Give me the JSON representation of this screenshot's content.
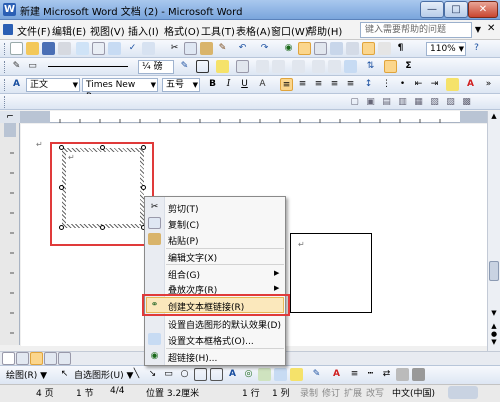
{
  "window": {
    "title": "新建 Microsoft Word 文档 (2) - Microsoft Word",
    "min_label": "—",
    "max_label": "□",
    "close_label": "✕"
  },
  "menubar": {
    "items": [
      "文件(F)",
      "编辑(E)",
      "视图(V)",
      "插入(I)",
      "格式(O)",
      "工具(T)",
      "表格(A)",
      "窗口(W)",
      "帮助(H)"
    ],
    "help_placeholder": "键入需要帮助的问题",
    "close_glyph": "✕"
  },
  "toolbar1": {
    "zoom": "110%"
  },
  "toolbar2": {
    "line_weight": "¼ 磅"
  },
  "formatting": {
    "style": "正文",
    "font": "Times New Roma",
    "size": "五号",
    "bold": "B",
    "italic": "I",
    "underline": "U"
  },
  "document": {
    "paragraph_mark": "↵",
    "cursor_mark": "↵"
  },
  "context_menu": {
    "items": [
      {
        "label": "剪切(T)",
        "icon": "scissors-icon"
      },
      {
        "label": "复制(C)",
        "icon": "copy-icon"
      },
      {
        "label": "粘贴(P)",
        "icon": "paste-icon"
      },
      {
        "label": "编辑文字(X)",
        "icon": ""
      },
      {
        "label": "组合(G)",
        "icon": "",
        "submenu": true
      },
      {
        "label": "叠放次序(R)",
        "icon": "",
        "submenu": true
      },
      {
        "label": "创建文本框链接(R)",
        "icon": "link-icon",
        "highlighted": true
      },
      {
        "label": "设置自选图形的默认效果(D)",
        "icon": ""
      },
      {
        "label": "设置文本框格式(O)...",
        "icon": "format-icon"
      },
      {
        "label": "超链接(H)...",
        "icon": "hyperlink-icon"
      }
    ]
  },
  "drawbar": {
    "draw_label": "绘图(R) ▼",
    "autoshape_label": "自选图形(U) ▼"
  },
  "statusbar": {
    "page": "4 页",
    "section": "1 节",
    "page_of": "4/4",
    "position": "位置 3.2厘米",
    "line": "1 行",
    "column": "1 列",
    "rec": "录制",
    "trk": "修订",
    "ext": "扩展",
    "ovr": "改写",
    "language": "中文(中国)"
  },
  "colors": {
    "annotation_red": "#e03a3a",
    "highlight": "#fbe8bc"
  }
}
